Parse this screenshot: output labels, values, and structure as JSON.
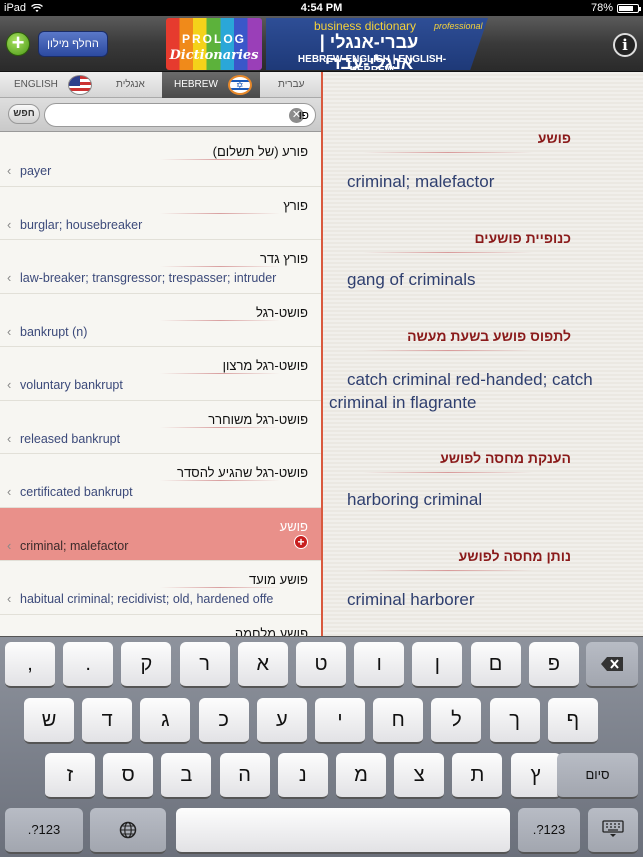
{
  "status": {
    "device": "iPad",
    "time": "4:54 PM",
    "battery": "78%",
    "battery_level": 0.78
  },
  "header": {
    "switch_label": "החלף מילון",
    "logo_line1": "PROLOG",
    "logo_line2": "Dictionaries",
    "banner_line1": "business dictionary",
    "banner_pro": "professional",
    "banner_line2": "עברי-אנגלי | אנגלי-עברי",
    "banner_line3": "HEBREW-ENGLISH | ENGLISH-HEBREW"
  },
  "tabs": {
    "english": "ENGLISH",
    "en_hebrew": "אנגלית",
    "hebrew": "HEBREW",
    "he_hebrew": "עברית"
  },
  "search": {
    "button": "חפש",
    "value": "פו"
  },
  "list": [
    {
      "he": "פורע (של תשלום)",
      "en": "payer"
    },
    {
      "he": "פורץ",
      "en": "burglar; housebreaker"
    },
    {
      "he": "פורץ גדר",
      "en": "law-breaker; transgressor; trespasser; intruder"
    },
    {
      "he": "פושט-רגל",
      "en": "bankrupt (n)"
    },
    {
      "he": "פושט-רגל מרצון",
      "en": "voluntary bankrupt"
    },
    {
      "he": "פושט-רגל משוחרר",
      "en": "released bankrupt"
    },
    {
      "he": "פושט-רגל שהגיע להסדר",
      "en": "certificated bankrupt"
    },
    {
      "he": "פושע",
      "en": "criminal; malefactor",
      "selected": true
    },
    {
      "he": "פושע מועד",
      "en": "habitual criminal; recidivist; old, hardened offe"
    },
    {
      "he": "פושע מלחמה",
      "en": ""
    }
  ],
  "detail": [
    {
      "he": "פושע",
      "en": "criminal; malefactor"
    },
    {
      "he": "כנופיית פושעים",
      "en": "gang of criminals"
    },
    {
      "he": "לתפוס פושע בשעת מעשה",
      "en": "catch criminal red-handed; catch criminal in flagrante"
    },
    {
      "he": "הענקת מחסה לפושע",
      "en": "harboring criminal"
    },
    {
      "he": "נותן מחסה לפושע",
      "en": "criminal harborer"
    }
  ],
  "keyboard": {
    "row1": [
      ",",
      ".",
      "ק",
      "ר",
      "א",
      "ט",
      "ו",
      "ן",
      "ם",
      "פ"
    ],
    "row2": [
      "ש",
      "ד",
      "ג",
      "כ",
      "ע",
      "י",
      "ח",
      "ל",
      "ך",
      "ף"
    ],
    "row3": [
      "ז",
      "ס",
      "ב",
      "ה",
      "נ",
      "מ",
      "צ",
      "ת",
      "ץ"
    ],
    "done": "סיום",
    "numbers": ".?123"
  }
}
